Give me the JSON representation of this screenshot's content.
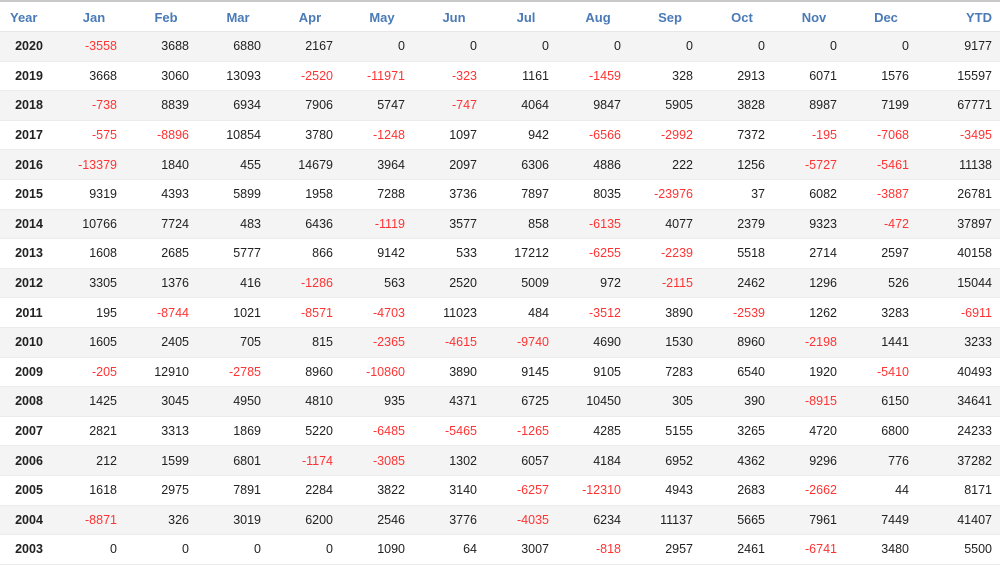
{
  "chart_data": {
    "type": "table",
    "columns": [
      "Year",
      "Jan",
      "Feb",
      "Mar",
      "Apr",
      "May",
      "Jun",
      "Jul",
      "Aug",
      "Sep",
      "Oct",
      "Nov",
      "Dec",
      "YTD"
    ],
    "rows": [
      [
        "2020",
        -3558,
        3688,
        6880,
        2167,
        0,
        0,
        0,
        0,
        0,
        0,
        0,
        0,
        9177
      ],
      [
        "2019",
        3668,
        3060,
        13093,
        -2520,
        -11971,
        -323,
        1161,
        -1459,
        328,
        2913,
        6071,
        1576,
        15597
      ],
      [
        "2018",
        -738,
        8839,
        6934,
        7906,
        5747,
        -747,
        4064,
        9847,
        5905,
        3828,
        8987,
        7199,
        67771
      ],
      [
        "2017",
        -575,
        -8896,
        10854,
        3780,
        -1248,
        1097,
        942,
        -6566,
        -2992,
        7372,
        -195,
        -7068,
        -3495
      ],
      [
        "2016",
        -13379,
        1840,
        455,
        14679,
        3964,
        2097,
        6306,
        4886,
        222,
        1256,
        -5727,
        -5461,
        11138
      ],
      [
        "2015",
        9319,
        4393,
        5899,
        1958,
        7288,
        3736,
        7897,
        8035,
        -23976,
        37,
        6082,
        -3887,
        26781
      ],
      [
        "2014",
        10766,
        7724,
        483,
        6436,
        -1119,
        3577,
        858,
        -6135,
        4077,
        2379,
        9323,
        -472,
        37897
      ],
      [
        "2013",
        1608,
        2685,
        5777,
        866,
        9142,
        533,
        17212,
        -6255,
        -2239,
        5518,
        2714,
        2597,
        40158
      ],
      [
        "2012",
        3305,
        1376,
        416,
        -1286,
        563,
        2520,
        5009,
        972,
        -2115,
        2462,
        1296,
        526,
        15044
      ],
      [
        "2011",
        195,
        -8744,
        1021,
        -8571,
        -4703,
        11023,
        484,
        -3512,
        3890,
        -2539,
        1262,
        3283,
        -6911
      ],
      [
        "2010",
        1605,
        2405,
        705,
        815,
        -2365,
        -4615,
        -9740,
        4690,
        1530,
        8960,
        -2198,
        1441,
        3233
      ],
      [
        "2009",
        -205,
        12910,
        -2785,
        8960,
        -10860,
        3890,
        9145,
        9105,
        7283,
        6540,
        1920,
        -5410,
        40493
      ],
      [
        "2008",
        1425,
        3045,
        4950,
        4810,
        935,
        4371,
        6725,
        10450,
        305,
        390,
        -8915,
        6150,
        34641
      ],
      [
        "2007",
        2821,
        3313,
        1869,
        5220,
        -6485,
        -5465,
        -1265,
        4285,
        5155,
        3265,
        4720,
        6800,
        24233
      ],
      [
        "2006",
        212,
        1599,
        6801,
        -1174,
        -3085,
        1302,
        6057,
        4184,
        6952,
        4362,
        9296,
        776,
        37282
      ],
      [
        "2005",
        1618,
        2975,
        7891,
        2284,
        3822,
        3140,
        -6257,
        -12310,
        4943,
        2683,
        -2662,
        44,
        8171
      ],
      [
        "2004",
        -8871,
        326,
        3019,
        6200,
        2546,
        3776,
        -4035,
        6234,
        11137,
        5665,
        7961,
        7449,
        41407
      ],
      [
        "2003",
        0,
        0,
        0,
        0,
        1090,
        64,
        3007,
        -818,
        2957,
        2461,
        -6741,
        3480,
        5500
      ]
    ]
  },
  "colors": {
    "header_text": "#4a7ab8",
    "negative": "#ff3333",
    "text": "#222222",
    "stripe": "#f4f4f4"
  }
}
